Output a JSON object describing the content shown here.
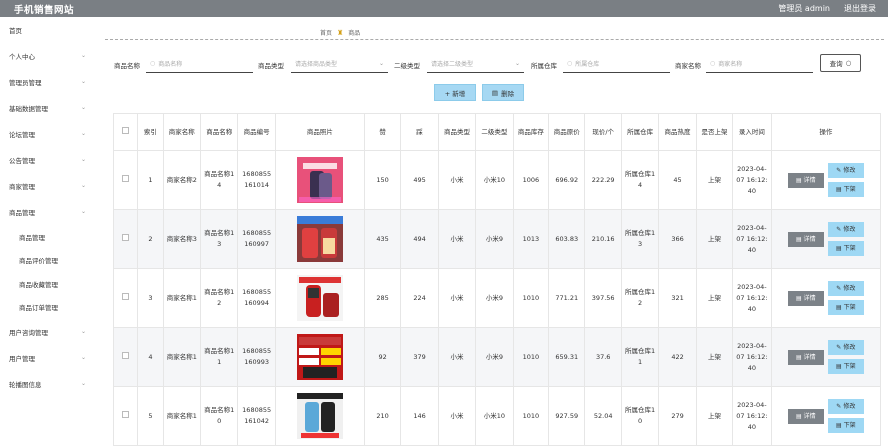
{
  "header": {
    "brand": "手机销售网站",
    "user": "管理员 admin",
    "logout": "退出登录"
  },
  "sidebar": {
    "items": [
      {
        "label": "首页",
        "chevron": false
      },
      {
        "label": "个人中心",
        "chevron": true
      },
      {
        "label": "管理员管理",
        "chevron": true
      },
      {
        "label": "基础数据管理",
        "chevron": true
      },
      {
        "label": "论坛管理",
        "chevron": true
      },
      {
        "label": "公告管理",
        "chevron": true
      },
      {
        "label": "商家管理",
        "chevron": true
      },
      {
        "label": "商品管理",
        "chevron": true
      }
    ],
    "submenu": [
      {
        "label": "商品管理"
      },
      {
        "label": "商品评价管理"
      },
      {
        "label": "商品收藏管理"
      },
      {
        "label": "商品订单管理"
      }
    ],
    "items_after": [
      {
        "label": "用户咨询管理"
      },
      {
        "label": "用户管理"
      },
      {
        "label": "轮播图信息"
      }
    ]
  },
  "breadcrumb": {
    "home": "首页",
    "current": "商品"
  },
  "filters": {
    "name_label": "商品名称",
    "name_placeholder": "商品名称",
    "type_label": "商品类型",
    "type_placeholder": "请选择商品类型",
    "subtype_label": "二级类型",
    "subtype_placeholder": "请选择二级类型",
    "warehouse_label": "所属仓库",
    "warehouse_placeholder": "所属仓库",
    "merchant_label": "商家名称",
    "merchant_placeholder": "商家名称",
    "query_label": "查询"
  },
  "actions": {
    "add_label": "+ 新增",
    "delete_label": "删除"
  },
  "table": {
    "headers": [
      "",
      "索引",
      "商家名称",
      "商品名称",
      "商品编号",
      "商品照片",
      "赞",
      "踩",
      "商品类型",
      "二级类型",
      "商品库存",
      "商品原价",
      "现价/个",
      "所属仓库",
      "商品热度",
      "是否上架",
      "录入时间",
      "操作"
    ],
    "detail_label": "详情",
    "edit_label": "修改",
    "off_label": "下架",
    "rows": [
      {
        "index": "1",
        "merchant": "商家名称2",
        "name": "商品名称14",
        "code": "1680855161014",
        "like": "150",
        "dislike": "495",
        "type": "小米",
        "subtype": "小米10",
        "stock": "1006",
        "price": "696.92",
        "now": "222.29",
        "warehouse": "所属仓库14",
        "heat": "45",
        "status": "上架",
        "time": "2023-04-07 16:12:40",
        "photo": "phone-pink"
      },
      {
        "index": "2",
        "merchant": "商家名称3",
        "name": "商品名称13",
        "code": "1680855160997",
        "like": "435",
        "dislike": "494",
        "type": "小米",
        "subtype": "小米9",
        "stock": "1013",
        "price": "603.83",
        "now": "210.16",
        "warehouse": "所属仓库13",
        "heat": "366",
        "status": "上架",
        "time": "2023-04-07 16:12:40",
        "photo": "phone-red-keypad"
      },
      {
        "index": "3",
        "merchant": "商家名称1",
        "name": "商品名称12",
        "code": "1680855160994",
        "like": "285",
        "dislike": "224",
        "type": "小米",
        "subtype": "小米9",
        "stock": "1010",
        "price": "771.21",
        "now": "397.56",
        "warehouse": "所属仓库12",
        "heat": "321",
        "status": "上架",
        "time": "2023-04-07 16:12:40",
        "photo": "phone-senior"
      },
      {
        "index": "4",
        "merchant": "商家名称1",
        "name": "商品名称11",
        "code": "1680855160993",
        "like": "92",
        "dislike": "379",
        "type": "小米",
        "subtype": "小米9",
        "stock": "1010",
        "price": "659.31",
        "now": "37.6",
        "warehouse": "所属仓库11",
        "heat": "422",
        "status": "上架",
        "time": "2023-04-07 16:12:40",
        "photo": "phone-fold-ad"
      },
      {
        "index": "5",
        "merchant": "商家名称1",
        "name": "商品名称10",
        "code": "1680855161042",
        "like": "210",
        "dislike": "146",
        "type": "小米",
        "subtype": "小米10",
        "stock": "1010",
        "price": "927.59",
        "now": "52.04",
        "warehouse": "所属仓库10",
        "heat": "279",
        "status": "上架",
        "time": "2023-04-07 16:12:40",
        "photo": "phone-black"
      }
    ]
  },
  "colors": {
    "header_bg": "#7a7f84",
    "button_blue": "#a6d8f3",
    "detail_gray": "#7c8288"
  }
}
